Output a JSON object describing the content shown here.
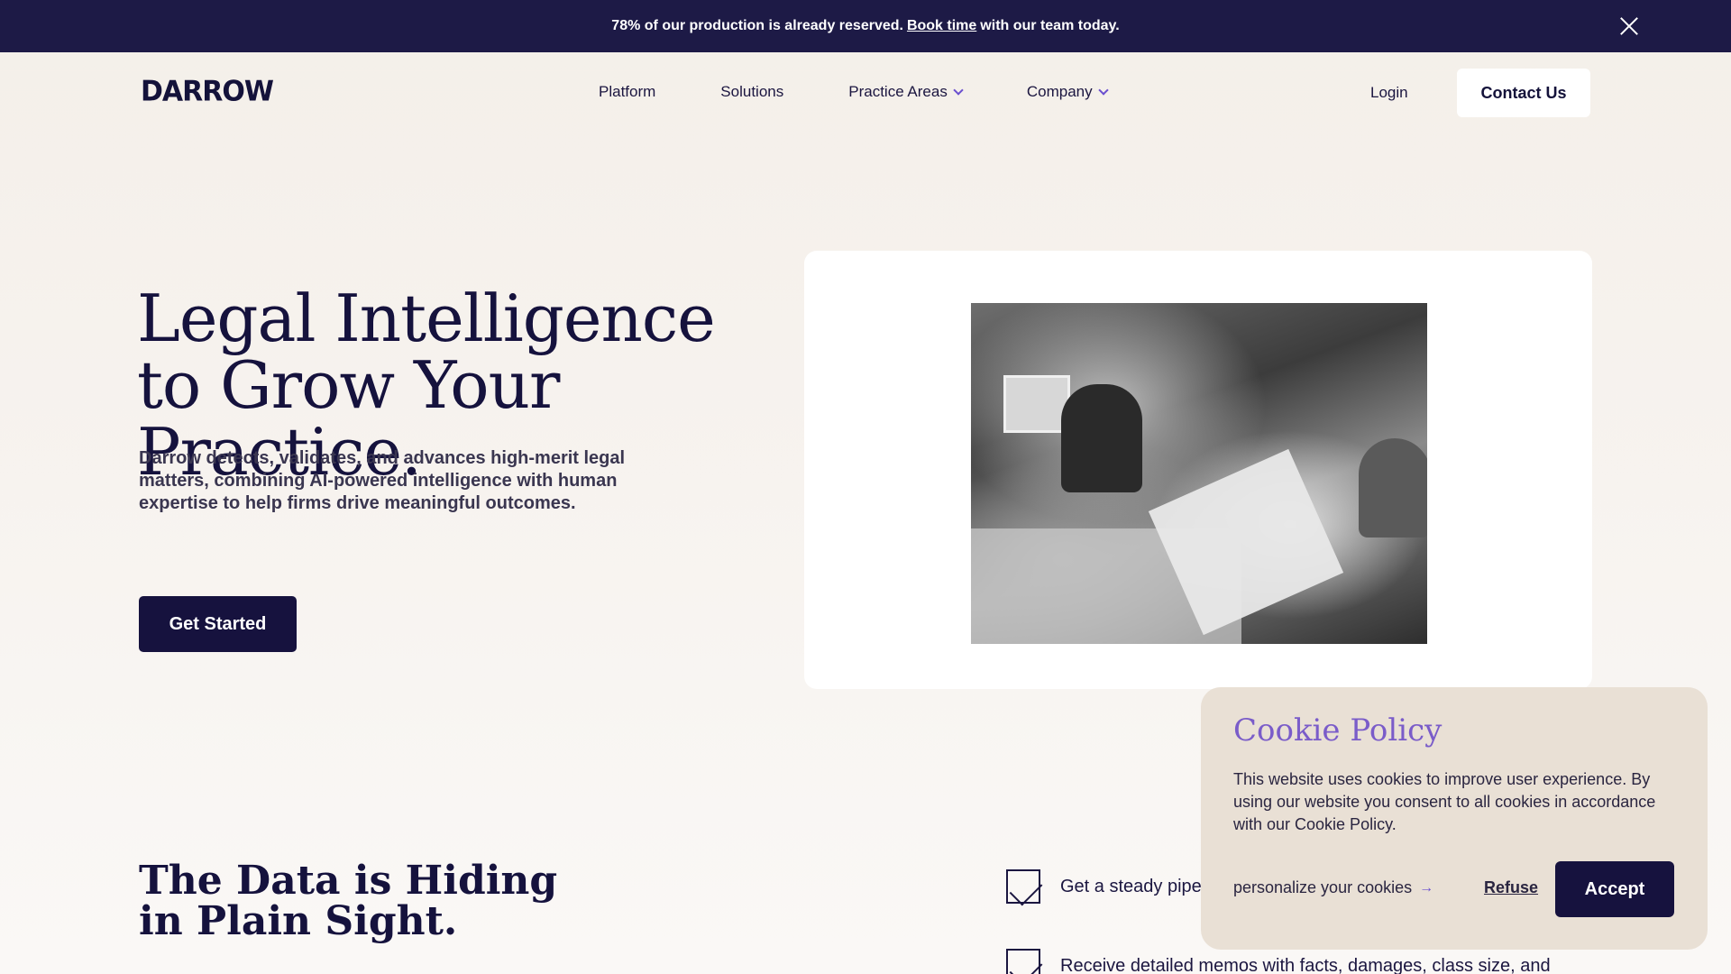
{
  "announcement": {
    "text_before": "78% of our production is already reserved.",
    "link": "Book time",
    "text_after": "with our team today."
  },
  "nav": {
    "logo": "DARROW",
    "links": [
      "Platform",
      "Solutions",
      "Practice Areas",
      "Company"
    ],
    "login": "Login",
    "contact": "Contact Us"
  },
  "hero": {
    "title": "Legal Intelligence to Grow Your Practice.",
    "description": "Darrow detects, validates, and advances high-merit legal matters, combining AI-powered intelligence with human expertise to help firms drive meaningful outcomes.",
    "cta": "Get Started"
  },
  "data_section": {
    "title": "The Data is Hiding in Plain Sight.",
    "features": [
      "Get a steady pipe",
      "Receive detailed memos with facts, damages, class size, and"
    ]
  },
  "cookie": {
    "title": "Cookie Policy",
    "text": "This website uses cookies to improve user experience.  By using our website you consent to all cookies in accordance with our Cookie Policy.",
    "personalize": "personalize your cookies",
    "personalize_arrow": "→",
    "refuse": "Refuse",
    "accept": "Accept"
  },
  "colors": {
    "dark_navy": "#16123e",
    "accent_purple": "#7a5cc9",
    "cookie_bg": "#e9e0d5"
  }
}
